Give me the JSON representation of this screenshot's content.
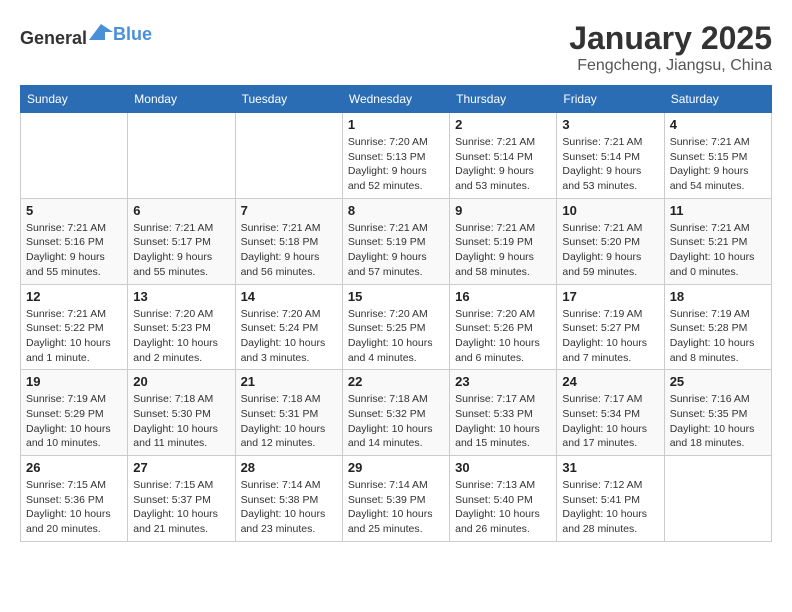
{
  "header": {
    "logo_general": "General",
    "logo_blue": "Blue",
    "month": "January 2025",
    "location": "Fengcheng, Jiangsu, China"
  },
  "weekdays": [
    "Sunday",
    "Monday",
    "Tuesday",
    "Wednesday",
    "Thursday",
    "Friday",
    "Saturday"
  ],
  "weeks": [
    [
      {
        "day": "",
        "info": ""
      },
      {
        "day": "",
        "info": ""
      },
      {
        "day": "",
        "info": ""
      },
      {
        "day": "1",
        "info": "Sunrise: 7:20 AM\nSunset: 5:13 PM\nDaylight: 9 hours\nand 52 minutes."
      },
      {
        "day": "2",
        "info": "Sunrise: 7:21 AM\nSunset: 5:14 PM\nDaylight: 9 hours\nand 53 minutes."
      },
      {
        "day": "3",
        "info": "Sunrise: 7:21 AM\nSunset: 5:14 PM\nDaylight: 9 hours\nand 53 minutes."
      },
      {
        "day": "4",
        "info": "Sunrise: 7:21 AM\nSunset: 5:15 PM\nDaylight: 9 hours\nand 54 minutes."
      }
    ],
    [
      {
        "day": "5",
        "info": "Sunrise: 7:21 AM\nSunset: 5:16 PM\nDaylight: 9 hours\nand 55 minutes."
      },
      {
        "day": "6",
        "info": "Sunrise: 7:21 AM\nSunset: 5:17 PM\nDaylight: 9 hours\nand 55 minutes."
      },
      {
        "day": "7",
        "info": "Sunrise: 7:21 AM\nSunset: 5:18 PM\nDaylight: 9 hours\nand 56 minutes."
      },
      {
        "day": "8",
        "info": "Sunrise: 7:21 AM\nSunset: 5:19 PM\nDaylight: 9 hours\nand 57 minutes."
      },
      {
        "day": "9",
        "info": "Sunrise: 7:21 AM\nSunset: 5:19 PM\nDaylight: 9 hours\nand 58 minutes."
      },
      {
        "day": "10",
        "info": "Sunrise: 7:21 AM\nSunset: 5:20 PM\nDaylight: 9 hours\nand 59 minutes."
      },
      {
        "day": "11",
        "info": "Sunrise: 7:21 AM\nSunset: 5:21 PM\nDaylight: 10 hours\nand 0 minutes."
      }
    ],
    [
      {
        "day": "12",
        "info": "Sunrise: 7:21 AM\nSunset: 5:22 PM\nDaylight: 10 hours\nand 1 minute."
      },
      {
        "day": "13",
        "info": "Sunrise: 7:20 AM\nSunset: 5:23 PM\nDaylight: 10 hours\nand 2 minutes."
      },
      {
        "day": "14",
        "info": "Sunrise: 7:20 AM\nSunset: 5:24 PM\nDaylight: 10 hours\nand 3 minutes."
      },
      {
        "day": "15",
        "info": "Sunrise: 7:20 AM\nSunset: 5:25 PM\nDaylight: 10 hours\nand 4 minutes."
      },
      {
        "day": "16",
        "info": "Sunrise: 7:20 AM\nSunset: 5:26 PM\nDaylight: 10 hours\nand 6 minutes."
      },
      {
        "day": "17",
        "info": "Sunrise: 7:19 AM\nSunset: 5:27 PM\nDaylight: 10 hours\nand 7 minutes."
      },
      {
        "day": "18",
        "info": "Sunrise: 7:19 AM\nSunset: 5:28 PM\nDaylight: 10 hours\nand 8 minutes."
      }
    ],
    [
      {
        "day": "19",
        "info": "Sunrise: 7:19 AM\nSunset: 5:29 PM\nDaylight: 10 hours\nand 10 minutes."
      },
      {
        "day": "20",
        "info": "Sunrise: 7:18 AM\nSunset: 5:30 PM\nDaylight: 10 hours\nand 11 minutes."
      },
      {
        "day": "21",
        "info": "Sunrise: 7:18 AM\nSunset: 5:31 PM\nDaylight: 10 hours\nand 12 minutes."
      },
      {
        "day": "22",
        "info": "Sunrise: 7:18 AM\nSunset: 5:32 PM\nDaylight: 10 hours\nand 14 minutes."
      },
      {
        "day": "23",
        "info": "Sunrise: 7:17 AM\nSunset: 5:33 PM\nDaylight: 10 hours\nand 15 minutes."
      },
      {
        "day": "24",
        "info": "Sunrise: 7:17 AM\nSunset: 5:34 PM\nDaylight: 10 hours\nand 17 minutes."
      },
      {
        "day": "25",
        "info": "Sunrise: 7:16 AM\nSunset: 5:35 PM\nDaylight: 10 hours\nand 18 minutes."
      }
    ],
    [
      {
        "day": "26",
        "info": "Sunrise: 7:15 AM\nSunset: 5:36 PM\nDaylight: 10 hours\nand 20 minutes."
      },
      {
        "day": "27",
        "info": "Sunrise: 7:15 AM\nSunset: 5:37 PM\nDaylight: 10 hours\nand 21 minutes."
      },
      {
        "day": "28",
        "info": "Sunrise: 7:14 AM\nSunset: 5:38 PM\nDaylight: 10 hours\nand 23 minutes."
      },
      {
        "day": "29",
        "info": "Sunrise: 7:14 AM\nSunset: 5:39 PM\nDaylight: 10 hours\nand 25 minutes."
      },
      {
        "day": "30",
        "info": "Sunrise: 7:13 AM\nSunset: 5:40 PM\nDaylight: 10 hours\nand 26 minutes."
      },
      {
        "day": "31",
        "info": "Sunrise: 7:12 AM\nSunset: 5:41 PM\nDaylight: 10 hours\nand 28 minutes."
      },
      {
        "day": "",
        "info": ""
      }
    ]
  ]
}
